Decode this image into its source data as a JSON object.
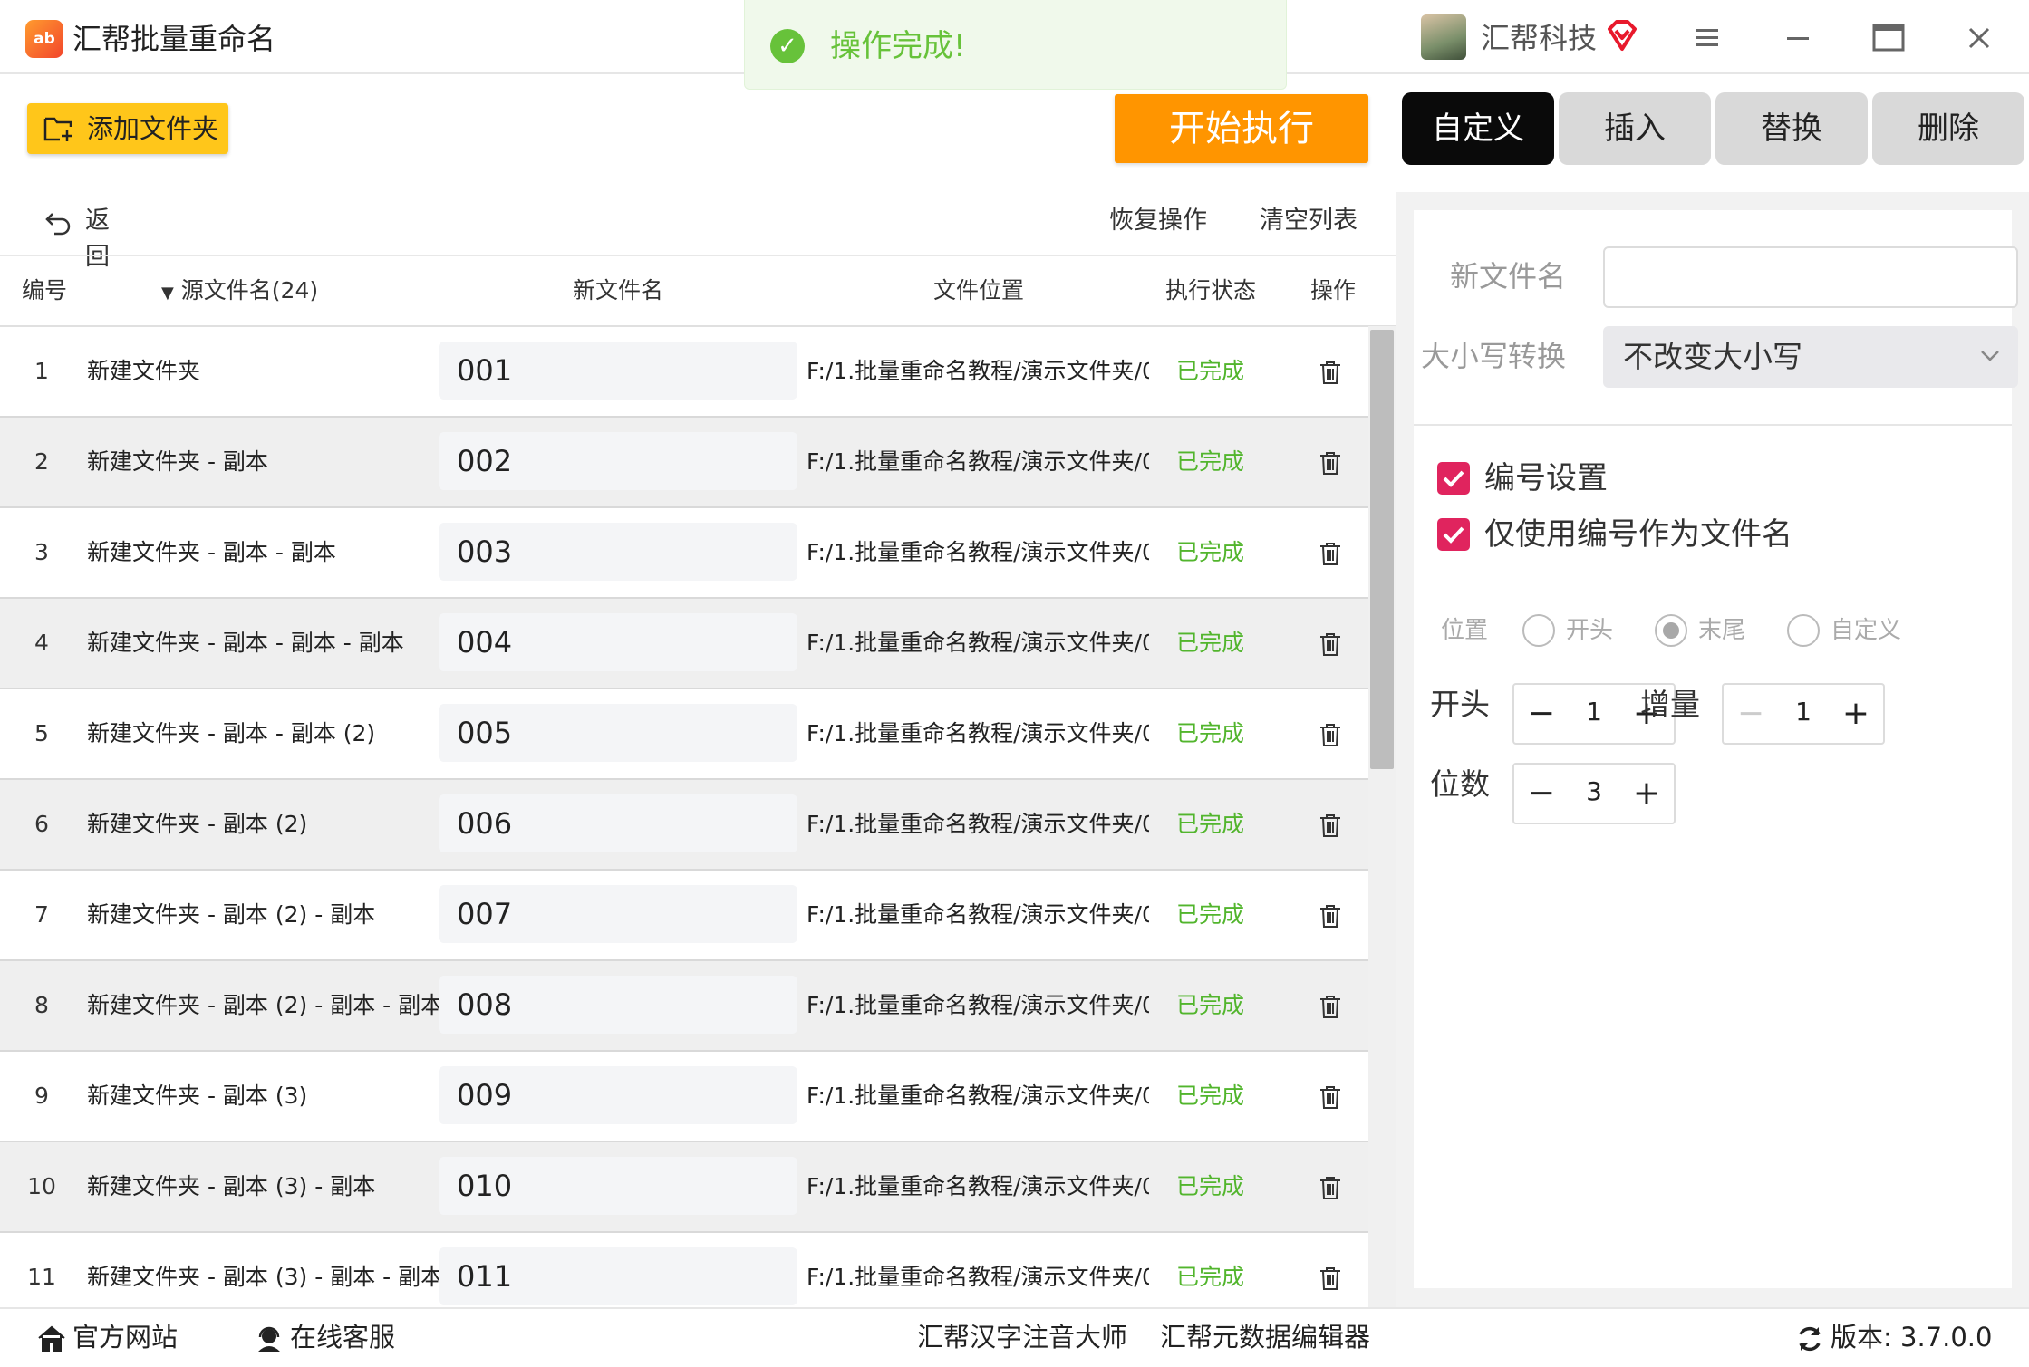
{
  "app": {
    "logo_text": "ab",
    "title": "汇帮批量重命名"
  },
  "toast": {
    "message": "操作完成!"
  },
  "user": {
    "company": "汇帮科技"
  },
  "toolbar": {
    "add_folder": "添加文件夹",
    "start": "开始执行"
  },
  "tabs": [
    {
      "label": "自定义",
      "active": true
    },
    {
      "label": "插入",
      "active": false
    },
    {
      "label": "替换",
      "active": false
    },
    {
      "label": "删除",
      "active": false
    }
  ],
  "list_actions": {
    "back": "返回",
    "restore": "恢复操作",
    "clear": "清空列表"
  },
  "table": {
    "headers": {
      "num": "编号",
      "source": "源文件名(24)",
      "new": "新文件名",
      "location": "文件位置",
      "status": "执行状态",
      "action": "操作"
    },
    "rows": [
      {
        "num": "1",
        "source": "新建文件夹",
        "new": "001",
        "path": "F:/1.批量重命名教程/演示文件夹/0(",
        "status": "已完成"
      },
      {
        "num": "2",
        "source": "新建文件夹 - 副本",
        "new": "002",
        "path": "F:/1.批量重命名教程/演示文件夹/0(",
        "status": "已完成"
      },
      {
        "num": "3",
        "source": "新建文件夹 - 副本 - 副本",
        "new": "003",
        "path": "F:/1.批量重命名教程/演示文件夹/0(",
        "status": "已完成"
      },
      {
        "num": "4",
        "source": "新建文件夹 - 副本 - 副本 - 副本",
        "new": "004",
        "path": "F:/1.批量重命名教程/演示文件夹/0(",
        "status": "已完成"
      },
      {
        "num": "5",
        "source": "新建文件夹 - 副本 - 副本 (2)",
        "new": "005",
        "path": "F:/1.批量重命名教程/演示文件夹/0(",
        "status": "已完成"
      },
      {
        "num": "6",
        "source": "新建文件夹 - 副本 (2)",
        "new": "006",
        "path": "F:/1.批量重命名教程/演示文件夹/0(",
        "status": "已完成"
      },
      {
        "num": "7",
        "source": "新建文件夹 - 副本 (2) - 副本",
        "new": "007",
        "path": "F:/1.批量重命名教程/演示文件夹/0(",
        "status": "已完成"
      },
      {
        "num": "8",
        "source": "新建文件夹 - 副本 (2) - 副本 - 副本",
        "new": "008",
        "path": "F:/1.批量重命名教程/演示文件夹/0(",
        "status": "已完成"
      },
      {
        "num": "9",
        "source": "新建文件夹 - 副本 (3)",
        "new": "009",
        "path": "F:/1.批量重命名教程/演示文件夹/0(",
        "status": "已完成"
      },
      {
        "num": "10",
        "source": "新建文件夹 - 副本 (3) - 副本",
        "new": "010",
        "path": "F:/1.批量重命名教程/演示文件夹/0'",
        "status": "已完成"
      },
      {
        "num": "11",
        "source": "新建文件夹 - 副本 (3) - 副本 - 副本",
        "new": "011",
        "path": "F:/1.批量重命名教程/演示文件夹/0'",
        "status": "已完成"
      }
    ]
  },
  "panel": {
    "new_name_label": "新文件名",
    "new_name_value": "",
    "case_label": "大小写转换",
    "case_value": "不改变大小写",
    "numbering_label": "编号设置",
    "numbering_checked": true,
    "only_number_label": "仅使用编号作为文件名",
    "only_number_checked": true,
    "position_label": "位置",
    "position_options": [
      "开头",
      "末尾",
      "自定义"
    ],
    "position_selected": "末尾",
    "start_label": "开头",
    "start_value": "1",
    "increment_label": "增量",
    "increment_value": "1",
    "digits_label": "位数",
    "digits_value": "3",
    "minus": "−",
    "plus": "+"
  },
  "footer": {
    "website": "官方网站",
    "support": "在线客服",
    "link1": "汇帮汉字注音大师",
    "link2": "汇帮元数据编辑器",
    "version": "版本: 3.7.0.0"
  },
  "colors": {
    "accent_orange": "#ff9500",
    "add_folder_yellow": "#ffc61a",
    "success_green": "#52b52d",
    "check_pink": "#e0245e"
  }
}
